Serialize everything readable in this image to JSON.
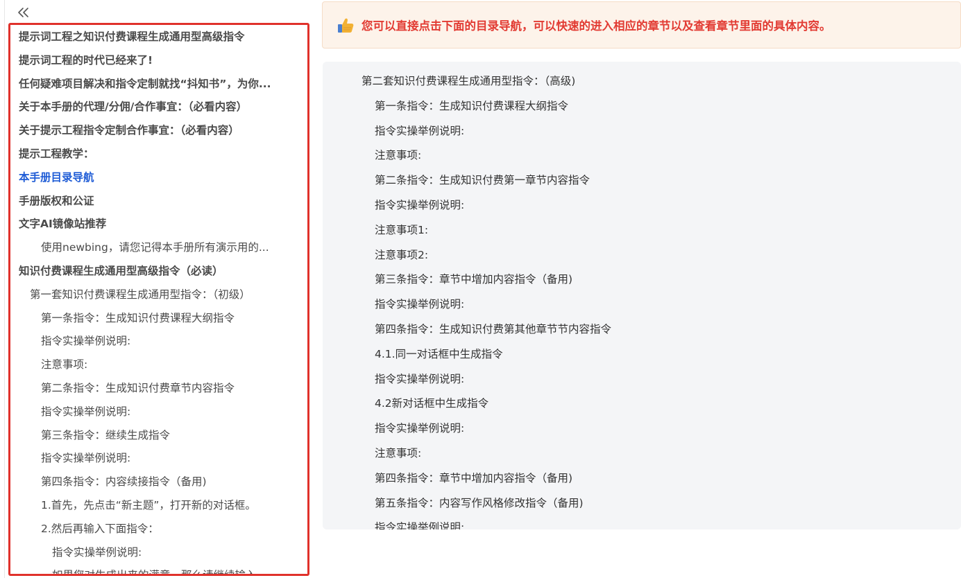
{
  "colors": {
    "sidebar_border": "#e0312b",
    "active_link": "#1f5cd6",
    "notice_bg": "#fdf3ea",
    "notice_text": "#e23b33",
    "content_bg": "#f4f5f7"
  },
  "sidebar": {
    "collapse_icon": "double-chevron-left-icon",
    "items": [
      {
        "label": "提示词工程之知识付费课程生成通用型高级指令",
        "level": 1,
        "active": false
      },
      {
        "label": "提示词工程的时代已经来了!",
        "level": 1,
        "active": false
      },
      {
        "label": "任何疑难项目解决和指令定制就找“抖知书”，为你...",
        "level": 1,
        "active": false
      },
      {
        "label": "关于本手册的代理/分佣/合作事宜：（必看内容）",
        "level": 1,
        "active": false
      },
      {
        "label": "关于提示工程指令定制合作事宜：（必看内容）",
        "level": 1,
        "active": false
      },
      {
        "label": "提示工程教学：",
        "level": 1,
        "active": false
      },
      {
        "label": "本手册目录导航",
        "level": 1,
        "active": true
      },
      {
        "label": "手册版权和公证",
        "level": 1,
        "active": false
      },
      {
        "label": "文字AI镜像站推荐",
        "level": 1,
        "active": false
      },
      {
        "label": "使用newbing，请您记得本手册所有演示用的...",
        "level": 3,
        "active": false
      },
      {
        "label": "知识付费课程生成通用型高级指令（必读）",
        "level": 1,
        "active": false
      },
      {
        "label": "第一套知识付费课程生成通用型指令：（初级）",
        "level": 2,
        "active": false
      },
      {
        "label": "第一条指令：生成知识付费课程大纲指令",
        "level": 3,
        "active": false
      },
      {
        "label": "指令实操举例说明:",
        "level": 3,
        "active": false
      },
      {
        "label": "注意事项:",
        "level": 3,
        "active": false
      },
      {
        "label": "第二条指令：生成知识付费章节内容指令",
        "level": 3,
        "active": false
      },
      {
        "label": "指令实操举例说明:",
        "level": 3,
        "active": false
      },
      {
        "label": "第三条指令：继续生成指令",
        "level": 3,
        "active": false
      },
      {
        "label": "指令实操举例说明:",
        "level": 3,
        "active": false
      },
      {
        "label": "第四条指令：内容续接指令（备用)",
        "level": 3,
        "active": false
      },
      {
        "label": "1.首先，先点击“新主题”，打开新的对话框。",
        "level": 3,
        "active": false
      },
      {
        "label": "2.然后再输入下面指令：",
        "level": 3,
        "active": false
      },
      {
        "label": "指令实操举例说明:",
        "level": 4,
        "active": false
      },
      {
        "label": "如果您对生成出来的满意，那么请继续输入...",
        "level": 4,
        "active": false
      }
    ]
  },
  "notice": {
    "icon": "thumbs-up-icon",
    "text": "您可以直接点击下面的目录导航，可以快速的进入相应的章节以及查看章节里面的具体内容。"
  },
  "content": {
    "items": [
      {
        "label": "第二套知识付费课程生成通用型指令：（高级)",
        "level": 1
      },
      {
        "label": "第一条指令：生成知识付费课程大纲指令",
        "level": 2
      },
      {
        "label": "指令实操举例说明:",
        "level": 2
      },
      {
        "label": "注意事项:",
        "level": 2
      },
      {
        "label": "第二条指令：生成知识付费第一章节内容指令",
        "level": 2
      },
      {
        "label": "指令实操举例说明:",
        "level": 2
      },
      {
        "label": "注意事项1:",
        "level": 2
      },
      {
        "label": "注意事项2:",
        "level": 2
      },
      {
        "label": "第三条指令：章节中增加内容指令（备用)",
        "level": 2
      },
      {
        "label": "指令实操举例说明:",
        "level": 2
      },
      {
        "label": "第四条指令：生成知识付费第其他章节节内容指令",
        "level": 2
      },
      {
        "label": "4.1.同一对话框中生成指令",
        "level": 2
      },
      {
        "label": "指令实操举例说明:",
        "level": 2
      },
      {
        "label": "4.2新对话框中生成指令",
        "level": 2
      },
      {
        "label": "指令实操举例说明:",
        "level": 2
      },
      {
        "label": "注意事项:",
        "level": 2
      },
      {
        "label": "第四条指令：章节中增加内容指令（备用)",
        "level": 2
      },
      {
        "label": "第五条指令：内容写作风格修改指令（备用)",
        "level": 2
      },
      {
        "label": "指令实操举例说明:",
        "level": 2
      }
    ]
  }
}
